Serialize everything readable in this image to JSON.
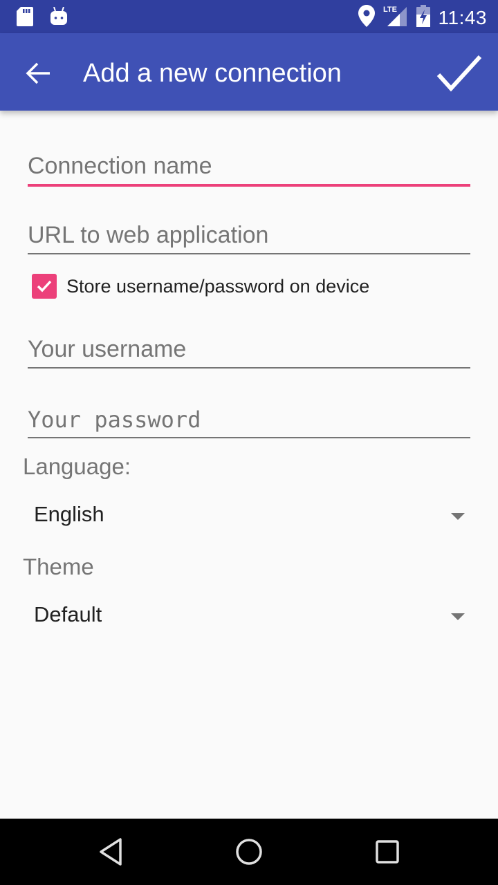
{
  "status_bar": {
    "time": "11:43",
    "left_icons": [
      "sd-card-icon",
      "android-debug-icon"
    ],
    "right_icons": [
      "location-icon",
      "lte-signal-icon",
      "battery-charging-icon"
    ],
    "network_label": "LTE"
  },
  "app_bar": {
    "title": "Add a new connection",
    "back_icon": "arrow-back-icon",
    "done_icon": "check-icon"
  },
  "form": {
    "connection_name": {
      "value": "",
      "placeholder": "Connection name",
      "focused": true
    },
    "url": {
      "value": "",
      "placeholder": "URL to web application"
    },
    "store_credentials": {
      "label": "Store username/password on device",
      "checked": true
    },
    "username": {
      "value": "",
      "placeholder": "Your username"
    },
    "password": {
      "value": "",
      "placeholder": "Your password"
    },
    "language": {
      "label": "Language:",
      "selected": "English"
    },
    "theme": {
      "label": "Theme",
      "selected": "Default"
    }
  },
  "nav_bar": {
    "buttons": [
      "back-triangle-icon",
      "home-circle-icon",
      "recents-square-icon"
    ]
  },
  "colors": {
    "status_bar": "#303f9f",
    "app_bar": "#3f51b5",
    "accent": "#ec407a",
    "hint": "#757575",
    "background": "#fafafa"
  }
}
